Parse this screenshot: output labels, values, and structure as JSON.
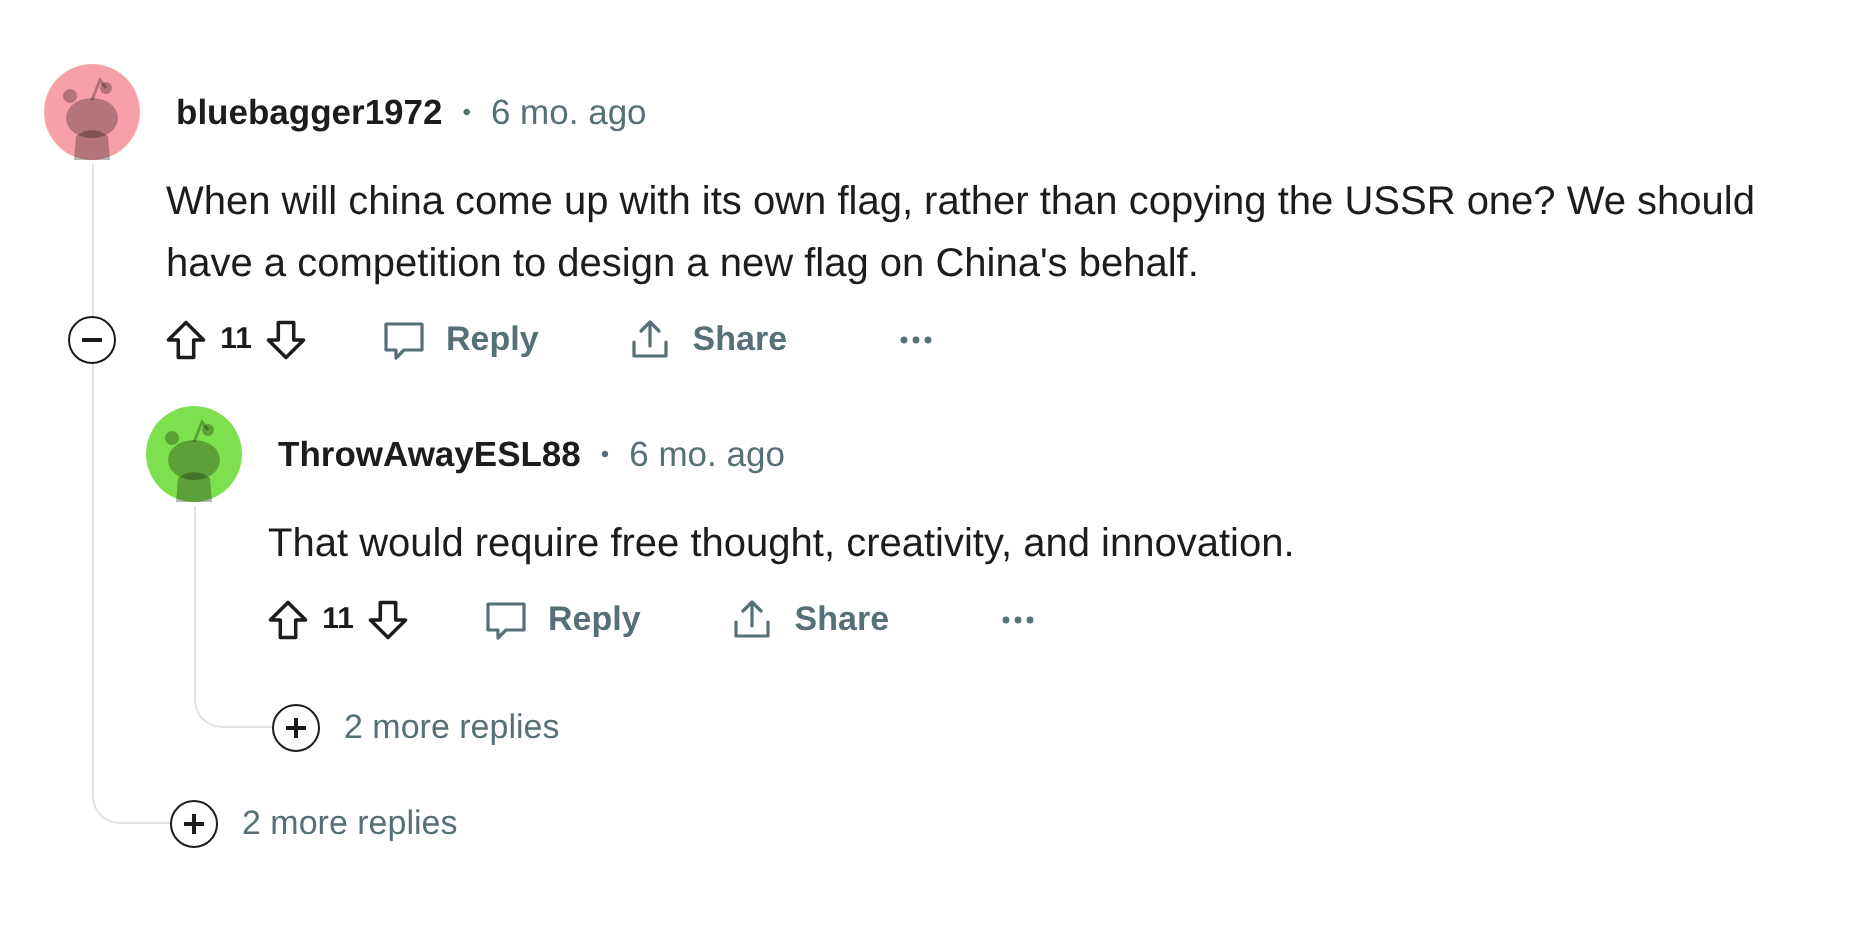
{
  "comments": [
    {
      "author": "bluebagger1972",
      "separator": "•",
      "age": "6 mo. ago",
      "color": "#f8a0a7",
      "expanded": true,
      "body": "When will china come up with its own flag, rather than copying the USSR one? We should have a competition to design a new flag on China's behalf.",
      "score": "11",
      "actions": [
        "Reply",
        "Share"
      ],
      "more_replies": "2 more replies",
      "replies": [
        {
          "author": "ThrowAwayESL88",
          "separator": "•",
          "age": "6 mo. ago",
          "color": "#7ee04e",
          "body": "That would require free thought, creativity, and innovation.",
          "score": "11",
          "actions": [
            "Reply",
            "Share"
          ],
          "more_replies": "2 more replies"
        }
      ]
    }
  ]
}
